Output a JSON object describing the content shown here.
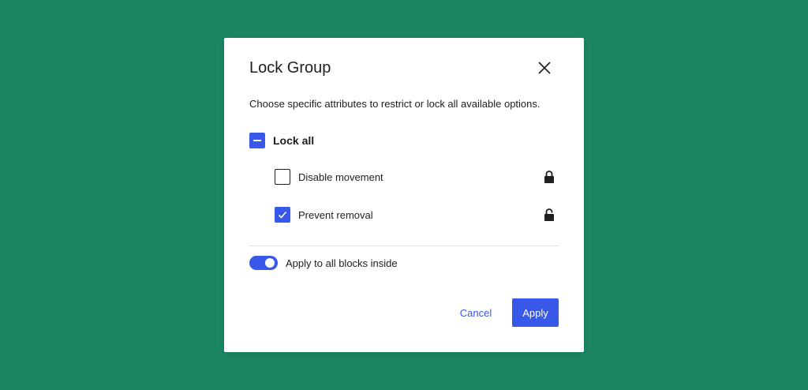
{
  "modal": {
    "title": "Lock Group",
    "description": "Choose specific attributes to restrict or lock all available options.",
    "lock_all": {
      "label": "Lock all",
      "state": "indeterminate"
    },
    "options": [
      {
        "label": "Disable movement",
        "checked": false,
        "lock_icon": "lock-closed-icon"
      },
      {
        "label": "Prevent removal",
        "checked": true,
        "lock_icon": "lock-open-icon"
      }
    ],
    "apply_inside": {
      "label": "Apply to all blocks inside",
      "enabled": true
    },
    "buttons": {
      "cancel": "Cancel",
      "apply": "Apply"
    }
  },
  "colors": {
    "background": "#1c8563",
    "accent": "#3858e9",
    "text": "#1e1e1e",
    "surface": "#ffffff"
  }
}
